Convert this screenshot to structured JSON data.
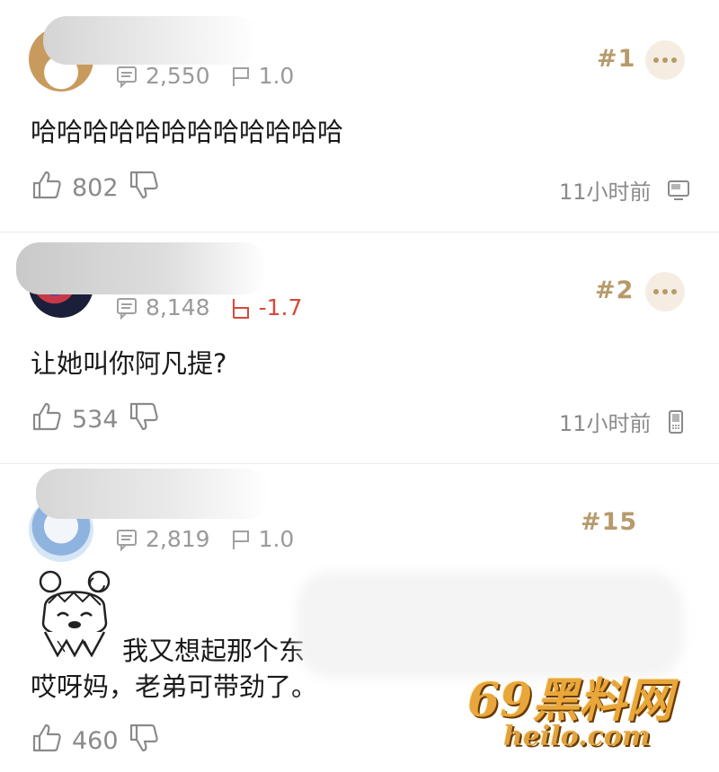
{
  "comments": [
    {
      "replies": "2,550",
      "level": "1.0",
      "rank": "#1",
      "text": "哈哈哈哈哈哈哈哈哈哈哈哈",
      "likes": "802",
      "time": "11小时前",
      "device_icon": "desktop-icon"
    },
    {
      "replies": "8,148",
      "level": "-1.7",
      "rank": "#2",
      "text": "让她叫你阿凡提?",
      "likes": "534",
      "time": "11小时前",
      "device_icon": "phone-icon"
    },
    {
      "replies": "2,819",
      "level": "1.0",
      "rank": "#15",
      "text_line1": "我又想起那个东",
      "text_line2": "哎呀妈，老弟可带劲了。",
      "likes": "460"
    }
  ],
  "watermark": {
    "brand": "69黑料网",
    "url": "heilo.com"
  },
  "colors": {
    "accent_gold": "#b79a6b",
    "negative_red": "#d9483b",
    "muted_gray": "#8a8a8a"
  }
}
